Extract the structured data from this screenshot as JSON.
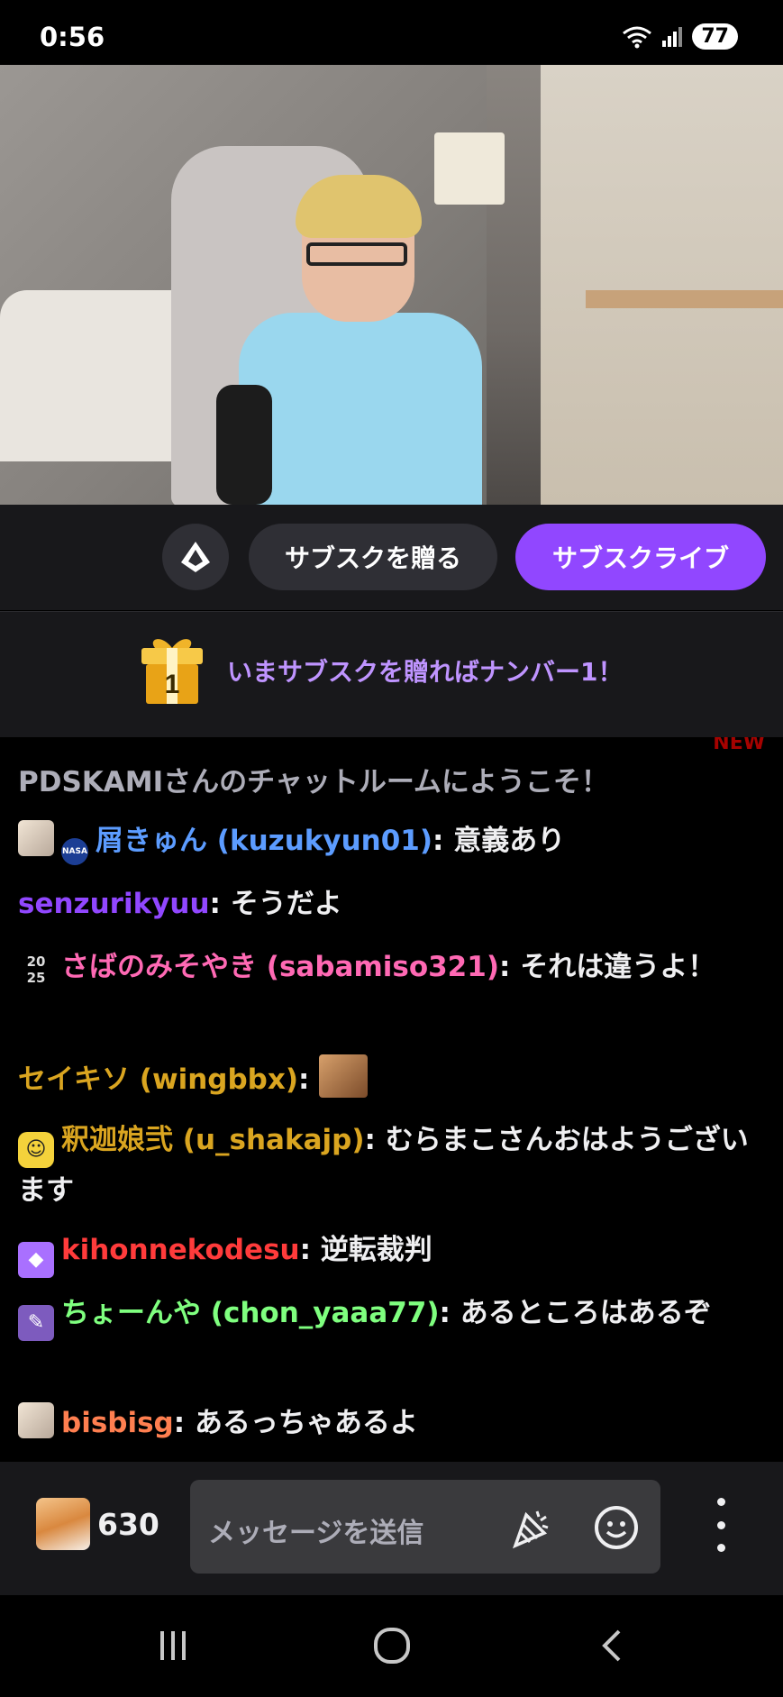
{
  "status_bar": {
    "time": "0:56",
    "battery": "77"
  },
  "actions": {
    "gift_sub": "サブスクを贈る",
    "subscribe": "サブスクライブ"
  },
  "banner": {
    "gift_number": "1",
    "text": "いまサブスクを贈ればナンバー1！"
  },
  "chat": {
    "new_tag": "NEW",
    "welcome": "PDSKAMIさんのチャットルームにようこそ！",
    "messages": [
      {
        "user": "屑きゅん (kuzukyun01)",
        "color": "#5c9cff",
        "text": "意義あり"
      },
      {
        "user": "senzurikyuu",
        "color": "#9147ff",
        "text": "そうだよ"
      },
      {
        "user": "さばのみそやき (sabamiso321)",
        "color": "#ff69b4",
        "text": "それは違うよ！"
      },
      {
        "user": "セイキソ (wingbbx)",
        "color": "#daa520",
        "text": ""
      },
      {
        "user": "釈迦娘弐 (u_shakajp)",
        "color": "#daa520",
        "text": "むらまこさんおはようございます"
      },
      {
        "user": "kihonnekodesu",
        "color": "#ff3b3b",
        "text": "逆転裁判"
      },
      {
        "user": "ちょーんや (chon_yaaa77)",
        "color": "#7fff7f",
        "text": "あるところはあるぞ"
      },
      {
        "user": "bisbisg",
        "color": "#ff7f50",
        "text": "あるっちゃあるよ"
      }
    ]
  },
  "input": {
    "points": "630",
    "placeholder": "メッセージを送信"
  }
}
